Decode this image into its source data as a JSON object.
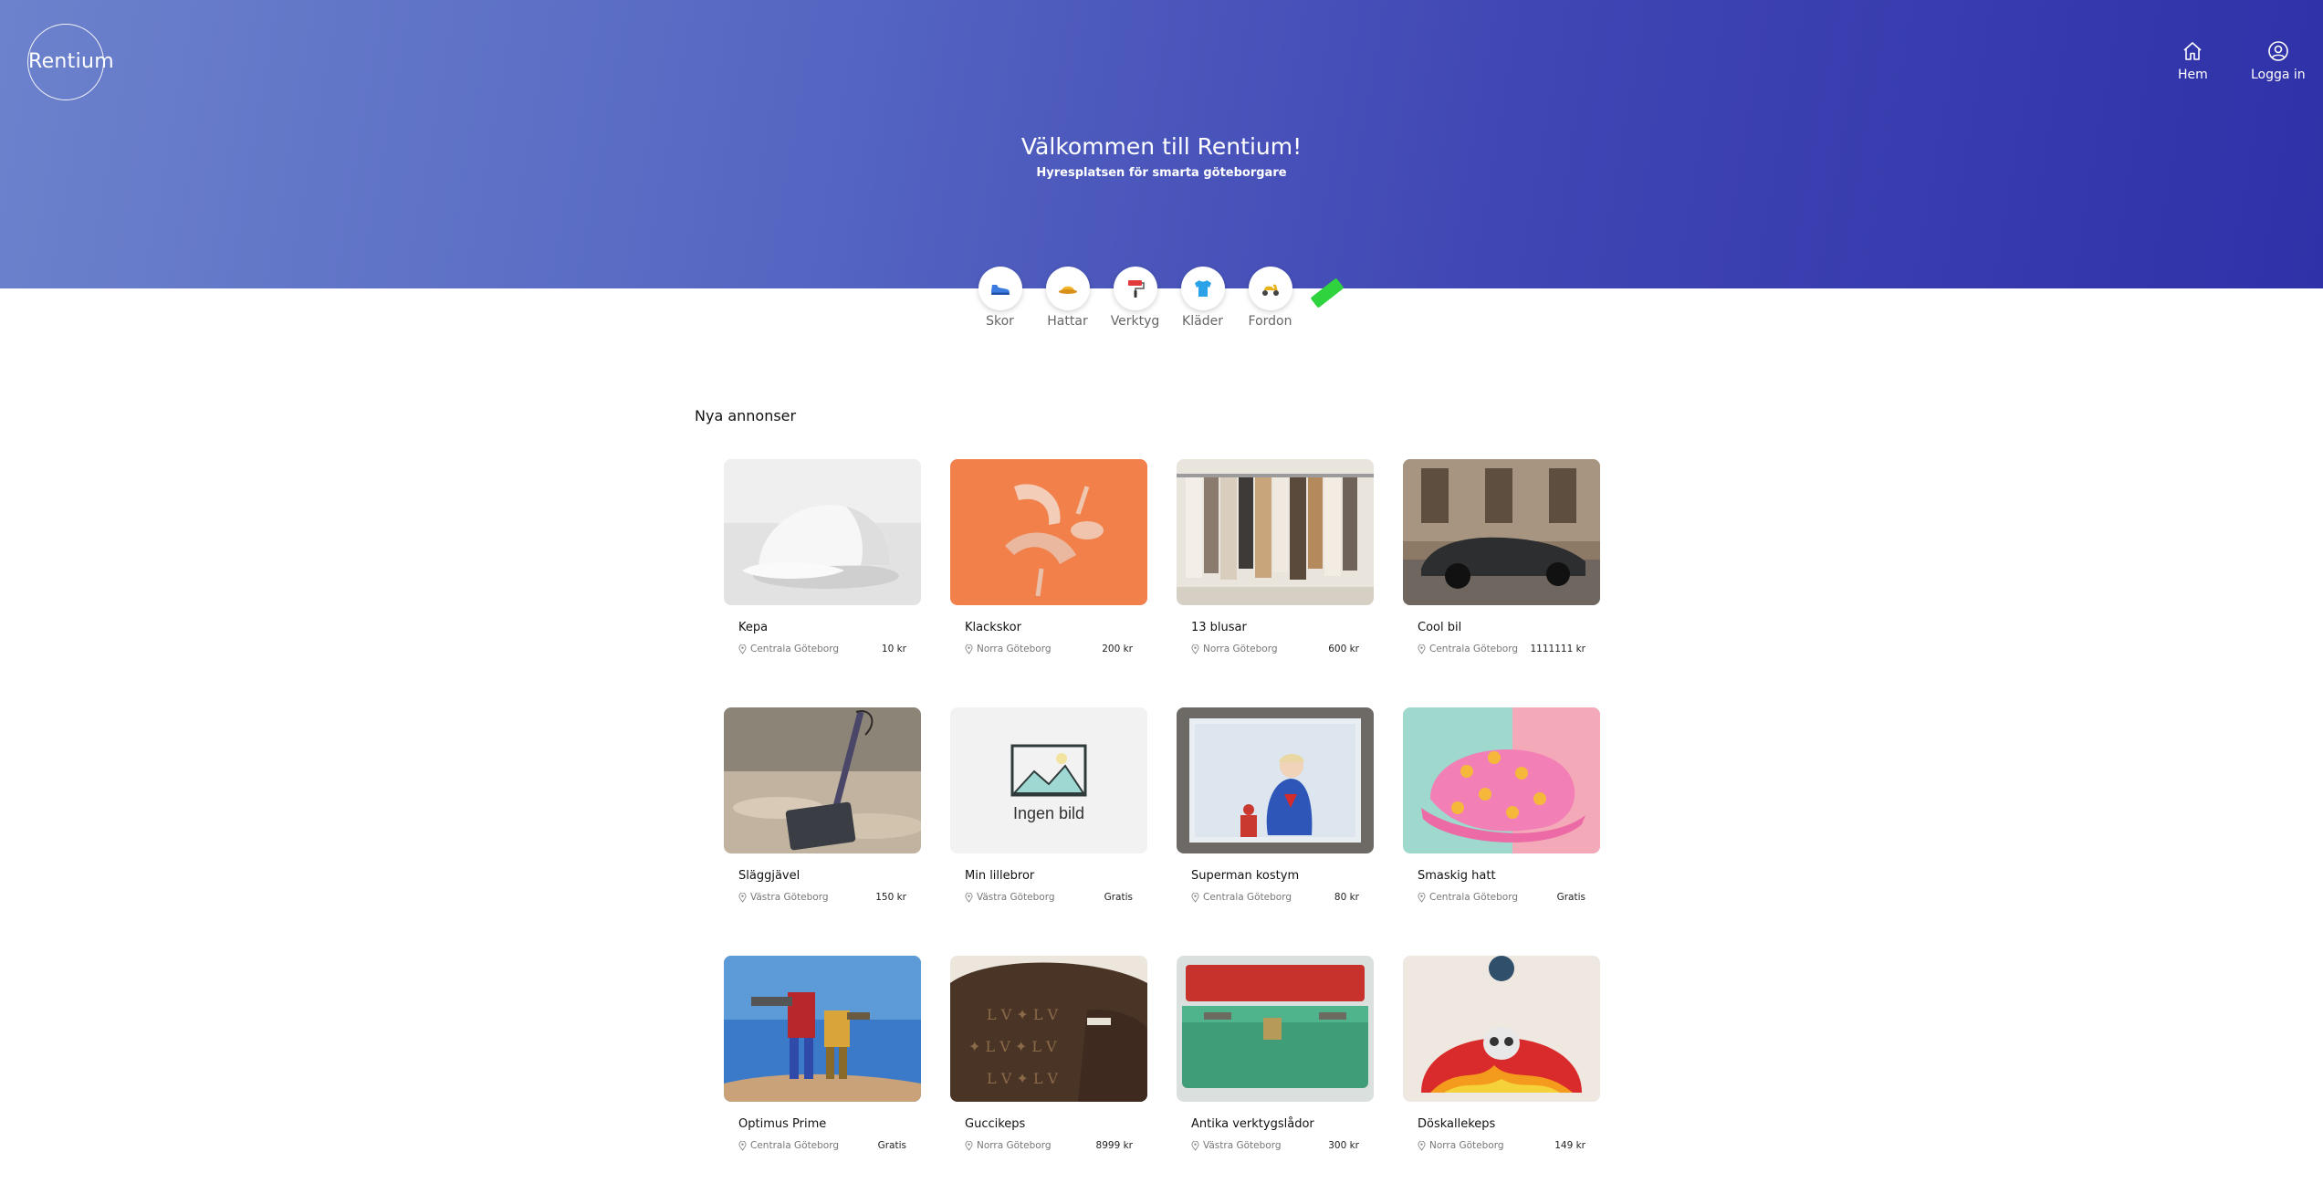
{
  "brand": {
    "logo_text": "Rentium"
  },
  "nav": {
    "home_label": "Hem",
    "login_label": "Logga in"
  },
  "hero": {
    "title": "Välkommen till Rentium!",
    "subtitle": "Hyresplatsen för smarta göteborgare"
  },
  "categories": [
    {
      "label": "Skor",
      "icon": "shoe-icon",
      "color": "#3b7be0"
    },
    {
      "label": "Hattar",
      "icon": "hat-icon",
      "color": "#f1b328"
    },
    {
      "label": "Verktyg",
      "icon": "paint-roller-icon",
      "color": "#e23b3b"
    },
    {
      "label": "Kläder",
      "icon": "shirt-icon",
      "color": "#2aa2e8"
    },
    {
      "label": "Fordon",
      "icon": "scooter-icon",
      "color": "#e8b21a"
    }
  ],
  "new_badge": "",
  "section": {
    "title": "Nya annonser"
  },
  "placeholder": {
    "text": "Ingen bild"
  },
  "listings": [
    {
      "title": "Kepa",
      "location": "Centrala Göteborg",
      "price": "10 kr"
    },
    {
      "title": "Klackskor",
      "location": "Norra Göteborg",
      "price": "200 kr"
    },
    {
      "title": "13 blusar",
      "location": "Norra Göteborg",
      "price": "600 kr"
    },
    {
      "title": "Cool bil",
      "location": "Centrala Göteborg",
      "price": "1111111 kr"
    },
    {
      "title": "Släggjävel",
      "location": "Västra Göteborg",
      "price": "150 kr"
    },
    {
      "title": "Min lillebror",
      "location": "Västra Göteborg",
      "price": "Gratis"
    },
    {
      "title": "Superman kostym",
      "location": "Centrala Göteborg",
      "price": "80 kr"
    },
    {
      "title": "Smaskig hatt",
      "location": "Centrala Göteborg",
      "price": "Gratis"
    },
    {
      "title": "Optimus Prime",
      "location": "Centrala Göteborg",
      "price": "Gratis"
    },
    {
      "title": "Guccikeps",
      "location": "Norra Göteborg",
      "price": "8999 kr"
    },
    {
      "title": "Antika verktygslådor",
      "location": "Västra Göteborg",
      "price": "300 kr"
    },
    {
      "title": "Döskallekeps",
      "location": "Norra Göteborg",
      "price": "149 kr"
    }
  ]
}
